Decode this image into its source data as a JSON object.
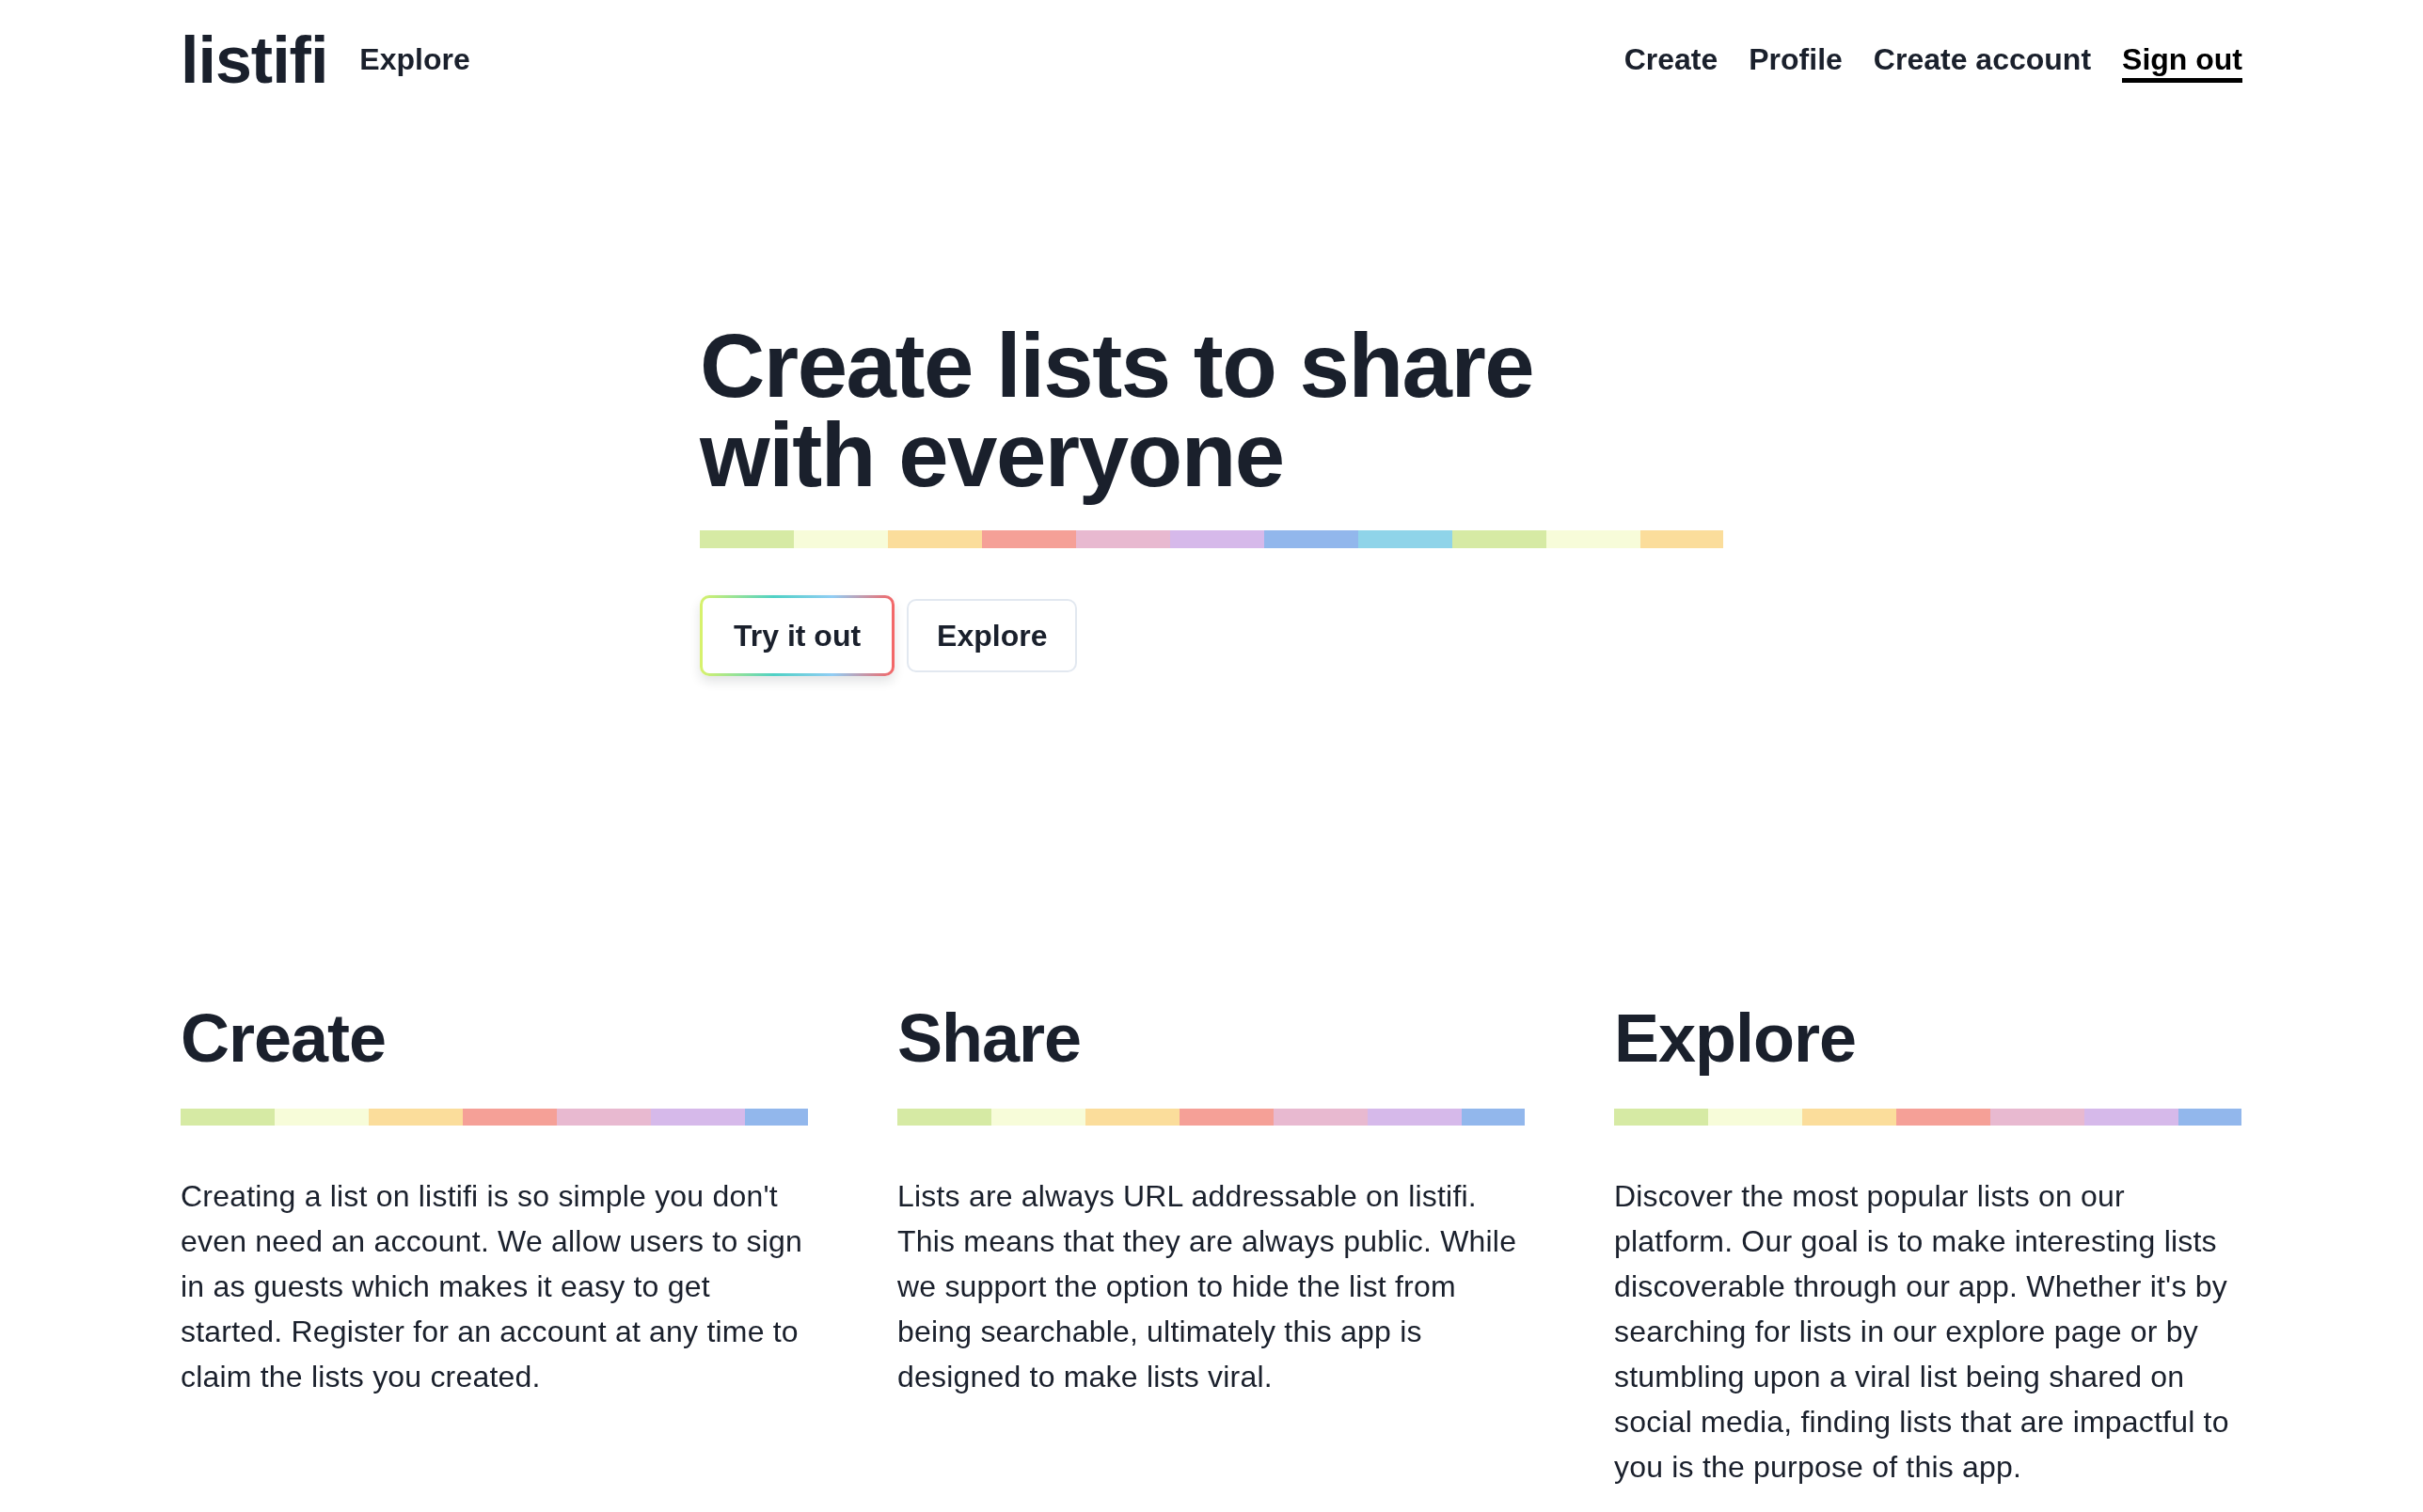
{
  "header": {
    "logo": "listifi",
    "left_nav": [
      {
        "label": "Explore",
        "selected": false
      }
    ],
    "right_nav": [
      {
        "label": "Create",
        "selected": false
      },
      {
        "label": "Profile",
        "selected": false
      },
      {
        "label": "Create account",
        "selected": false
      },
      {
        "label": "Sign out",
        "selected": true
      }
    ]
  },
  "hero": {
    "title": "Create lists to share with everyone",
    "buttons": [
      {
        "label": "Try it out",
        "kind": "primary"
      },
      {
        "label": "Explore",
        "kind": "secondary"
      }
    ]
  },
  "features": [
    {
      "title": "Create",
      "text": "Creating a list on listifi is so simple you don't even need an account. We allow users to sign in as guests which makes it easy to get started. Register for an account at any time to claim the lists you created."
    },
    {
      "title": "Share",
      "text": "Lists are always URL addressable on listifi. This means that they are always public. While we support the option to hide the list from being searchable, ultimately this app is designed to make lists viral."
    },
    {
      "title": "Explore",
      "text": "Discover the most popular lists on our platform. Our goal is to make interesting lists discoverable through our app. Whether it's by searching for lists in our explore page or by stumbling upon a viral list being shared on social media, finding lists that are impactful to you is the purpose of this app."
    }
  ]
}
